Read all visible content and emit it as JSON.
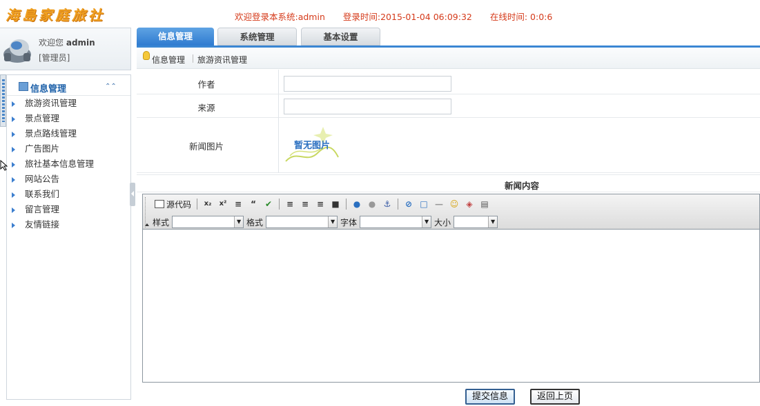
{
  "header": {
    "logo_text": "海島家庭旅社",
    "welcome_system": "欢迎登录本系统:admin",
    "login_time": "登录时间:2015-01-04 06:09:32",
    "online_time": "在线时间: 0:0:6"
  },
  "user": {
    "welcome_prefix": "欢迎您",
    "name": "admin",
    "role": "[管理员]"
  },
  "sidebar": {
    "section_title": "信息管理",
    "items": [
      {
        "label": "旅游资讯管理"
      },
      {
        "label": "景点管理"
      },
      {
        "label": "景点路线管理"
      },
      {
        "label": "广告图片"
      },
      {
        "label": "旅社基本信息管理"
      },
      {
        "label": "网站公告"
      },
      {
        "label": "联系我们"
      },
      {
        "label": "留言管理"
      },
      {
        "label": "友情链接"
      }
    ]
  },
  "tabs": [
    {
      "label": "信息管理",
      "active": true
    },
    {
      "label": "系统管理",
      "active": false
    },
    {
      "label": "基本设置",
      "active": false
    }
  ],
  "breadcrumb": {
    "root": "信息管理",
    "current": "旅游资讯管理"
  },
  "form": {
    "author_label": "作者",
    "author_value": "",
    "source_label": "来源",
    "source_value": "",
    "image_label": "新闻图片",
    "no_image_text": "暂无图片",
    "content_label": "新闻内容"
  },
  "editor": {
    "source_button": "源代码",
    "style_label": "样式",
    "format_label": "格式",
    "font_label": "字体",
    "size_label": "大小"
  },
  "buttons": {
    "submit": "提交信息",
    "back": "返回上页"
  },
  "colors": {
    "accent": "#2f7bd0",
    "status_text": "#d53a1a",
    "logo": "#f0a020"
  }
}
